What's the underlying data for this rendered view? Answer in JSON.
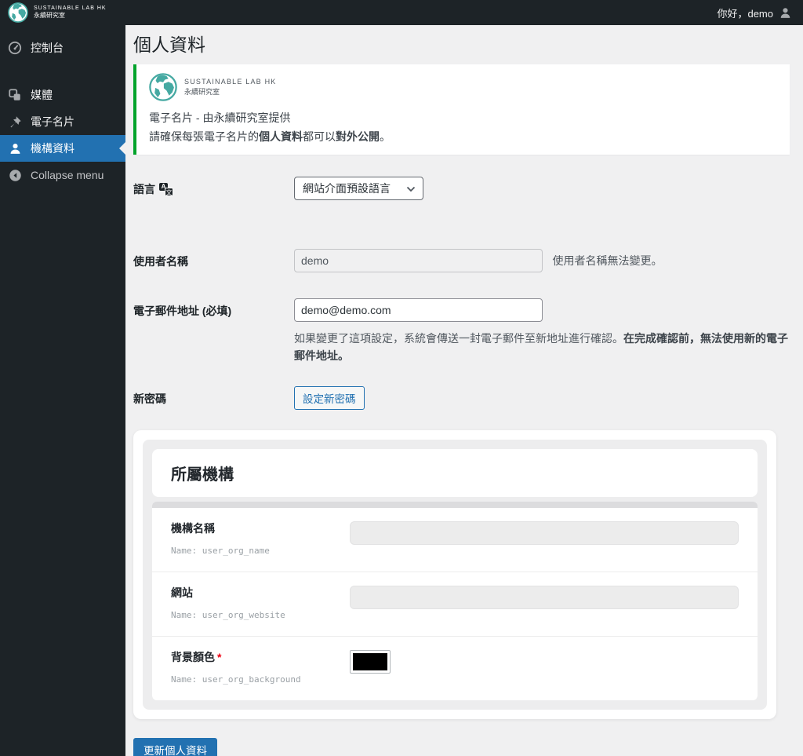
{
  "admin_bar": {
    "brand_line1": "SUSTAINABLE LAB HK",
    "brand_line2": "永續研究室",
    "greeting": "你好，demo"
  },
  "sidebar": {
    "items": [
      {
        "label": "控制台",
        "icon": "dashboard-icon",
        "active": false
      },
      {
        "label": "媒體",
        "icon": "media-icon",
        "active": false
      },
      {
        "label": "電子名片",
        "icon": "pushpin-icon",
        "active": false
      },
      {
        "label": "機構資料",
        "icon": "user-icon",
        "active": true
      },
      {
        "label": "Collapse menu",
        "icon": "collapse-icon",
        "active": false
      }
    ]
  },
  "page": {
    "title": "個人資料",
    "notice": {
      "brand_line1": "SUSTAINABLE LAB HK",
      "brand_line2": "永續研究室",
      "line1": "電子名片 - 由永續研究室提供",
      "line2_prefix": "請確保每張電子名片的",
      "line2_bold1": "個人資料",
      "line2_mid": "都可以",
      "line2_bold2": "對外公開",
      "line2_suffix": "。"
    },
    "form": {
      "language": {
        "label": "語言",
        "selected": "網站介面預設語言"
      },
      "username": {
        "label": "使用者名稱",
        "value": "demo",
        "description": "使用者名稱無法變更。"
      },
      "email": {
        "label": "電子郵件地址 (必填)",
        "value": "demo@demo.com",
        "description_normal": "如果變更了這項設定，系統會傳送一封電子郵件至新地址進行確認。",
        "description_bold": "在完成確認前，無法使用新的電子郵件地址。"
      },
      "password": {
        "label": "新密碼",
        "button_label": "設定新密碼"
      }
    },
    "organization": {
      "title": "所屬機構",
      "required_mark": "*",
      "rows": [
        {
          "label": "機構名稱",
          "name": "Name: user_org_name",
          "type": "text",
          "value": ""
        },
        {
          "label": "網站",
          "name": "Name: user_org_website",
          "type": "text",
          "value": ""
        },
        {
          "label": "背景顏色",
          "name": "Name: user_org_background",
          "type": "color",
          "value": "#000000"
        }
      ]
    },
    "submit_label": "更新個人資料"
  },
  "colors": {
    "accent_blue": "#2271b1",
    "notice_green": "#00a32a",
    "brand_teal": "#45a9a2",
    "sidebar_dark": "#1d2327",
    "swatch_black": "#000000"
  }
}
